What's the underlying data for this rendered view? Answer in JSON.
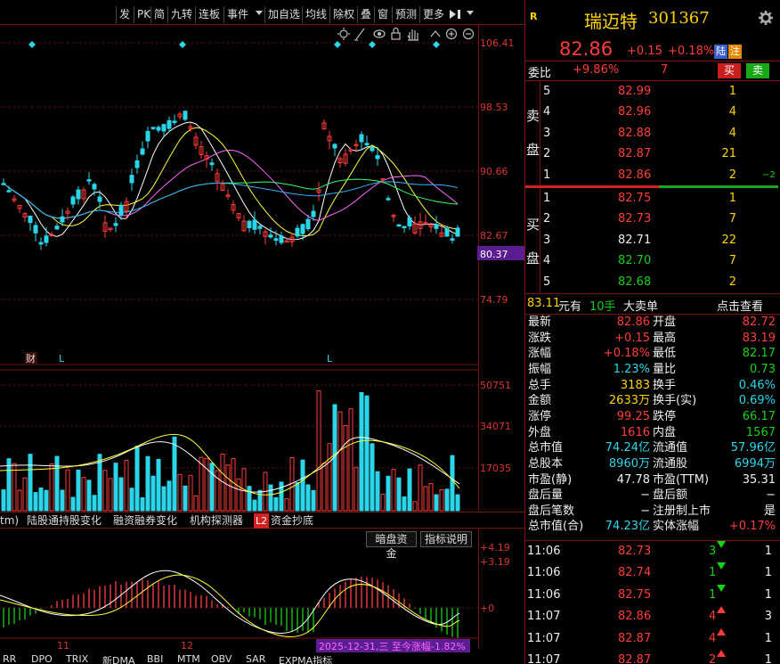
{
  "toolbar": {
    "items": [
      "发",
      "PK",
      "简",
      "九转",
      "连板",
      "事件",
      "加自选",
      "均线",
      "除权",
      "叠",
      "窗",
      "预测",
      "更多"
    ]
  },
  "price_axis": {
    "labels": [
      "106.41",
      "98.53",
      "90.66",
      "82.67",
      "74.79"
    ],
    "current_marker": "80.37"
  },
  "markers": {
    "cai": "财",
    "L1": "L",
    "L2": "L"
  },
  "volume_axis": {
    "labels": [
      "50751",
      "34071",
      "17035"
    ]
  },
  "tabs_a": [
    {
      "label": "tm)"
    },
    {
      "label": "陆股通持股变化"
    },
    {
      "label": "融资融券变化"
    },
    {
      "label": "机构探测器"
    },
    {
      "badge": "L2",
      "label": "资金抄底"
    }
  ],
  "indicator": {
    "btn_dark": "暗盘资金",
    "btn_help": "指标说明",
    "axis": [
      "+4.19",
      "+3.19",
      "+0"
    ],
    "date_labels": [
      "11",
      "12"
    ],
    "status": "2025-12-31,三 至今涨幅-1.82%"
  },
  "tabs_b": [
    "RR",
    "DPO",
    "TRIX",
    "新DMA",
    "BBI",
    "MTM",
    "OBV",
    "SAR",
    "EXPMA指标"
  ],
  "header": {
    "r_badge": "R",
    "name": "瑞迈特",
    "code": "301367",
    "price": "82.86",
    "change": "+0.15",
    "pct": "+0.18%",
    "badge_lu": "陆",
    "badge_zhu": "注"
  },
  "weibi": {
    "label": "委比",
    "pct": "+9.86%",
    "diff": "7",
    "buy_btn": "买",
    "sell_btn": "卖"
  },
  "sell_label": [
    "卖",
    "盘"
  ],
  "buy_label": [
    "买",
    "盘"
  ],
  "sell_levels": [
    {
      "level": "5",
      "price": "82.99",
      "vol": "1",
      "extra": ""
    },
    {
      "level": "4",
      "price": "82.96",
      "vol": "4",
      "extra": ""
    },
    {
      "level": "3",
      "price": "82.88",
      "vol": "4",
      "extra": ""
    },
    {
      "level": "2",
      "price": "82.87",
      "vol": "21",
      "extra": ""
    },
    {
      "level": "1",
      "price": "82.86",
      "vol": "2",
      "extra": "−2"
    }
  ],
  "buy_levels": [
    {
      "level": "1",
      "price": "82.75",
      "vol": "1"
    },
    {
      "level": "2",
      "price": "82.73",
      "vol": "7"
    },
    {
      "level": "3",
      "price": "82.71",
      "vol": "22"
    },
    {
      "level": "4",
      "price": "82.70",
      "vol": "7"
    },
    {
      "level": "5",
      "price": "82.68",
      "vol": "2"
    }
  ],
  "big_order": {
    "amount": "83.11",
    "unit1": "元有",
    "count": "10手",
    "text": "大卖单",
    "link": "点击查看"
  },
  "quotes": [
    {
      "l1": "最新",
      "v1": "82.86",
      "c1": "red",
      "l2": "开盘",
      "v2": "82.72",
      "c2": "red"
    },
    {
      "l1": "涨跌",
      "v1": "+0.15",
      "c1": "red",
      "l2": "最高",
      "v2": "83.19",
      "c2": "red"
    },
    {
      "l1": "涨幅",
      "v1": "+0.18%",
      "c1": "red",
      "l2": "最低",
      "v2": "82.17",
      "c2": "green"
    },
    {
      "l1": "振幅",
      "v1": "1.23%",
      "c1": "cyan",
      "l2": "量比",
      "v2": "0.73",
      "c2": "green"
    },
    {
      "l1": "总手",
      "v1": "3183",
      "c1": "yellow",
      "l2": "换手",
      "v2": "0.46%",
      "c2": "cyan"
    },
    {
      "l1": "金额",
      "v1": "2633万",
      "c1": "yellow",
      "l2": "换手(实)",
      "v2": "0.69%",
      "c2": "cyan"
    },
    {
      "l1": "涨停",
      "v1": "99.25",
      "c1": "red",
      "l2": "跌停",
      "v2": "66.17",
      "c2": "green"
    },
    {
      "l1": "外盘",
      "v1": "1616",
      "c1": "red",
      "l2": "内盘",
      "v2": "1567",
      "c2": "green"
    },
    {
      "l1": "总市值",
      "v1": "74.24亿",
      "c1": "cyan",
      "l2": "流通值",
      "v2": "57.96亿",
      "c2": "cyan"
    },
    {
      "l1": "总股本",
      "v1": "8960万",
      "c1": "cyan",
      "l2": "流通股",
      "v2": "6994万",
      "c2": "cyan"
    },
    {
      "l1": "市盈(静)",
      "v1": "47.78",
      "c1": "white",
      "l2": "市盈(TTM)",
      "v2": "35.31",
      "c2": "white"
    },
    {
      "l1": "盘后量",
      "v1": "−",
      "c1": "white",
      "l2": "盘后额",
      "v2": "−",
      "c2": "white"
    },
    {
      "l1": "盘后笔数",
      "v1": "−",
      "c1": "white",
      "l2": "注册制上市",
      "v2": "是",
      "c2": "white"
    },
    {
      "l1": "总市值(合)",
      "v1": "74.23亿",
      "c1": "cyan",
      "l2": "实体涨幅",
      "v2": "+0.17%",
      "c2": "red"
    }
  ],
  "ticks": [
    {
      "time": "11:06",
      "price": "82.73",
      "pc": "red",
      "vol": "3",
      "dir": "dn",
      "n": "1"
    },
    {
      "time": "11:06",
      "price": "82.74",
      "pc": "red",
      "vol": "1",
      "dir": "dn",
      "n": "1"
    },
    {
      "time": "11:06",
      "price": "82.75",
      "pc": "red",
      "vol": "1",
      "dir": "dn",
      "n": "1"
    },
    {
      "time": "11:07",
      "price": "82.86",
      "pc": "red",
      "vol": "4",
      "dir": "up",
      "n": "3"
    },
    {
      "time": "11:07",
      "price": "82.87",
      "pc": "red",
      "vol": "4",
      "dir": "up",
      "n": "1"
    },
    {
      "time": "11:07",
      "price": "82.87",
      "pc": "red",
      "vol": "2",
      "dir": "up",
      "n": "1"
    }
  ],
  "colors": {
    "up": "#ff3c3c",
    "down": "#2ad7ea",
    "frame": "#7a1010",
    "ma5": "#ffffff",
    "ma10": "#ffff33",
    "ma20": "#ff66ff",
    "ma60": "#33ff66",
    "ma120": "#33b0ff"
  }
}
